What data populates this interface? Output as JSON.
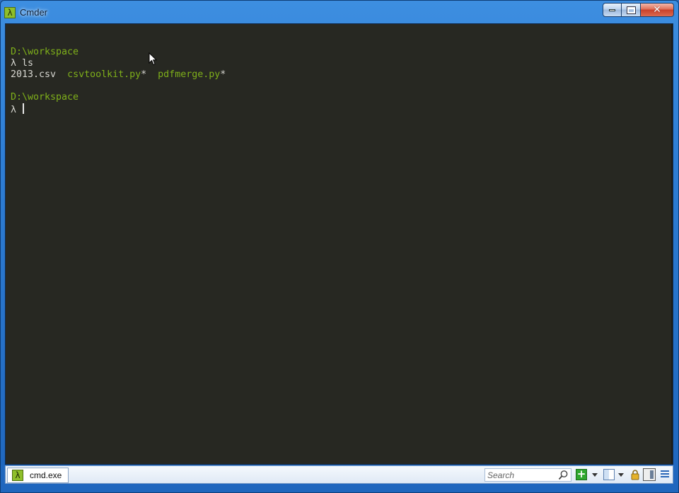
{
  "window": {
    "title": "Cmder",
    "app_icon_glyph": "λ"
  },
  "caption_buttons": {
    "minimize_icon": "minimize-icon",
    "maximize_icon": "maximize-icon",
    "close_glyph": "✕"
  },
  "console": {
    "lines": {
      "prompt_path_1": "D:\\workspace",
      "prompt_symbol_1": "λ",
      "command_1": " ls",
      "file_1": "2013.csv",
      "file_2": "csvtoolkit.py",
      "file_2_suffix": "*",
      "file_3": "pdfmerge.py",
      "file_3_suffix": "*",
      "prompt_path_2": "D:\\workspace",
      "prompt_symbol_2": "λ"
    },
    "colors": {
      "background": "#272822",
      "foreground": "#d8d8d2",
      "accent_green": "#7fb01a"
    }
  },
  "statusbar": {
    "tab_label": "cmd.exe",
    "tab_icon_glyph": "λ",
    "search_placeholder": "Search",
    "new_console_glyph": "+"
  }
}
